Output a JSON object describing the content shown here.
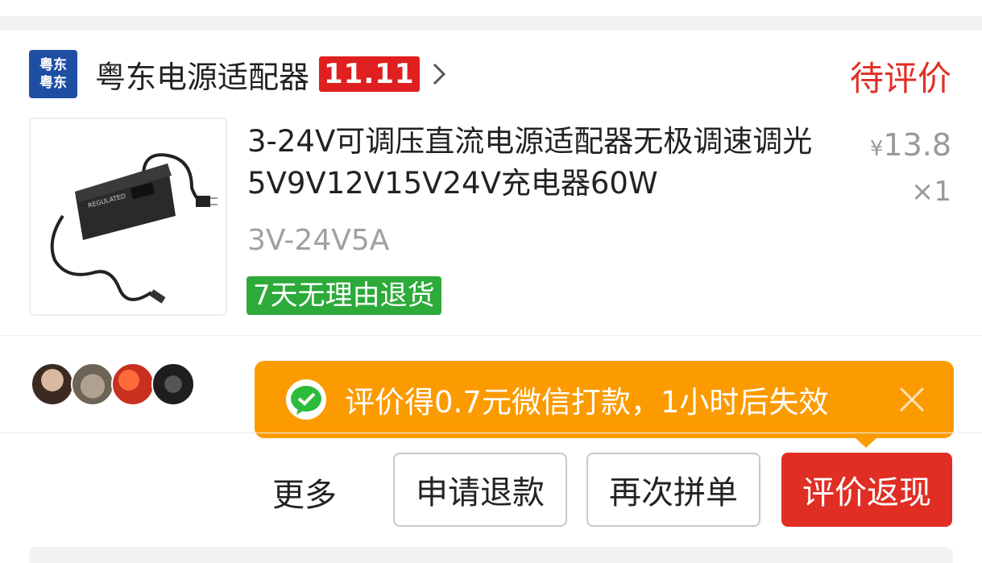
{
  "shop": {
    "logo_line1": "粤东",
    "logo_line2": "粤东",
    "name": "粤东电源适配器",
    "promo_badge": "11.11"
  },
  "order": {
    "status": "待评价",
    "product_title": "3-24V可调压直流电源适配器无极调速调光5V9V12V15V24V充电器60W",
    "price_symbol": "¥",
    "price": "13.8",
    "quantity": "×1",
    "spec": "3V-24V5A",
    "return_tag": "7天无理由退货"
  },
  "tooltip": {
    "text": "评价得0.7元微信打款，1小时后失效"
  },
  "actions": {
    "more": "更多",
    "refund": "申请退款",
    "reorder": "再次拼单",
    "review": "评价返现"
  },
  "colors": {
    "accent_red": "#e02e24",
    "tooltip_orange": "#fb9b00",
    "tag_green": "#2daa3a",
    "shop_logo_blue": "#1f4fa3"
  }
}
